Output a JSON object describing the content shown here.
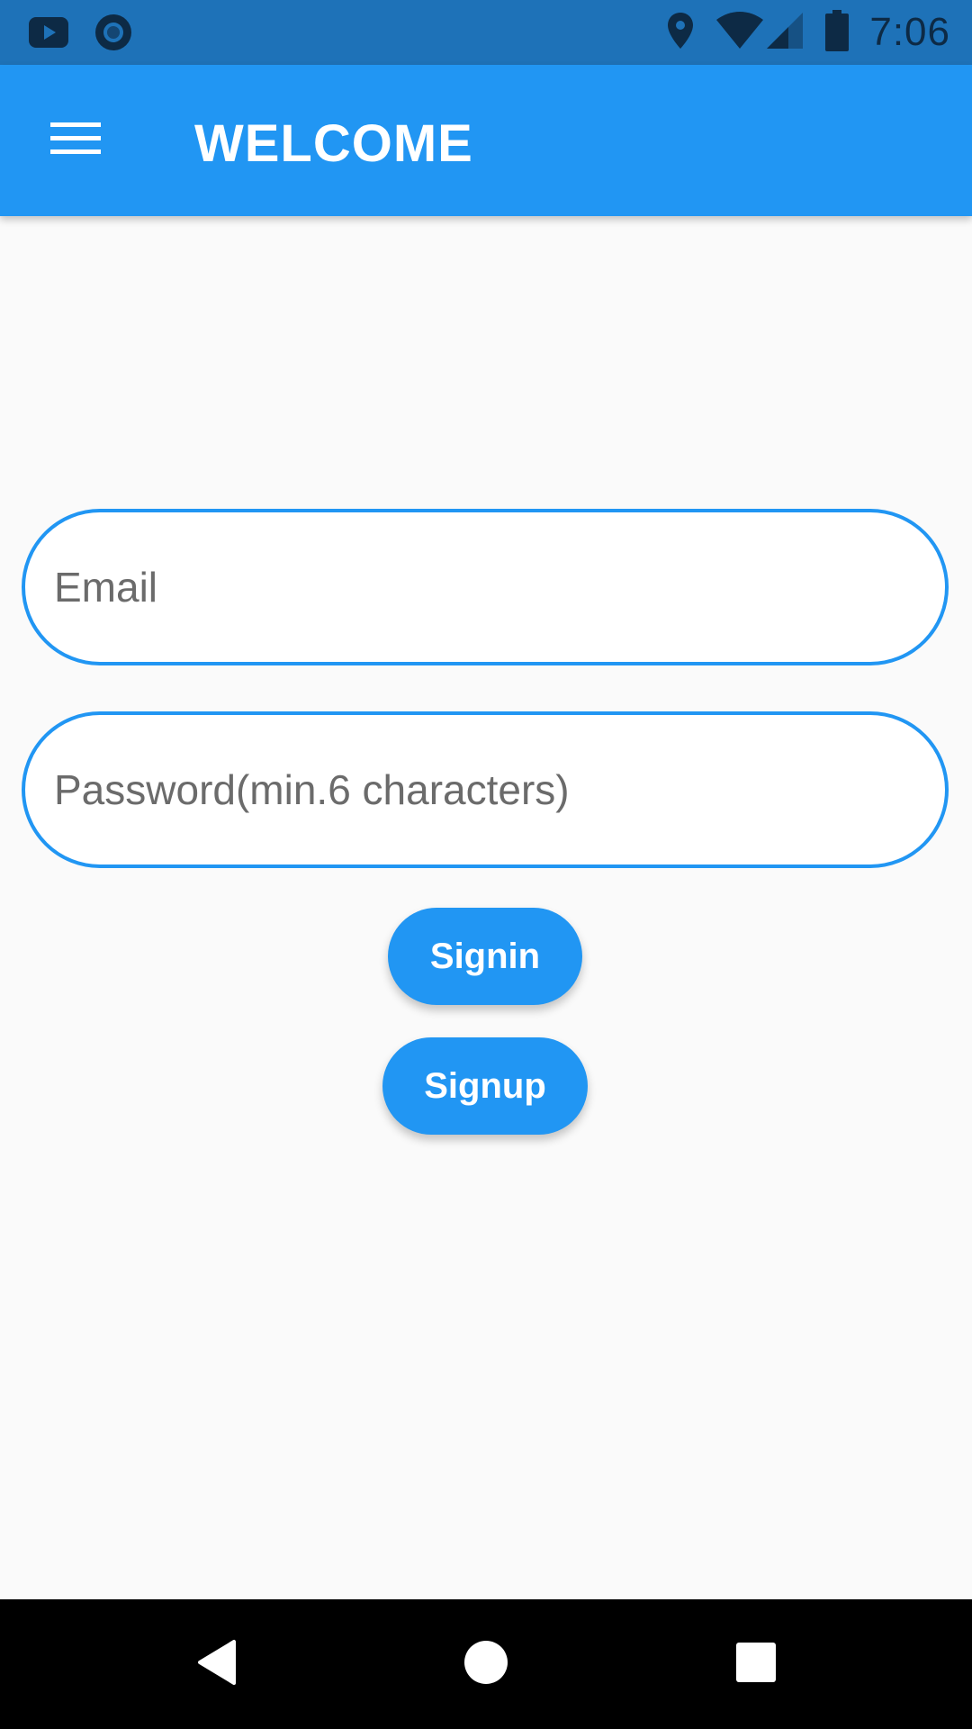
{
  "status_bar": {
    "time": "7:06",
    "icons": [
      "youtube-icon",
      "circle-app-icon",
      "location-icon",
      "wifi-icon",
      "signal-icon",
      "battery-icon"
    ]
  },
  "app_bar": {
    "title": "WELCOME",
    "menu_icon": "hamburger-menu-icon"
  },
  "form": {
    "email_placeholder": "Email",
    "password_placeholder": "Password(min.6 characters)",
    "signin_label": "Signin",
    "signup_label": "Signup"
  },
  "nav_bar": {
    "icons": [
      "back-icon",
      "home-icon",
      "recents-icon"
    ]
  },
  "colors": {
    "primary": "#2196f3",
    "status_bar": "#1e72b8",
    "background": "#fafafa"
  }
}
